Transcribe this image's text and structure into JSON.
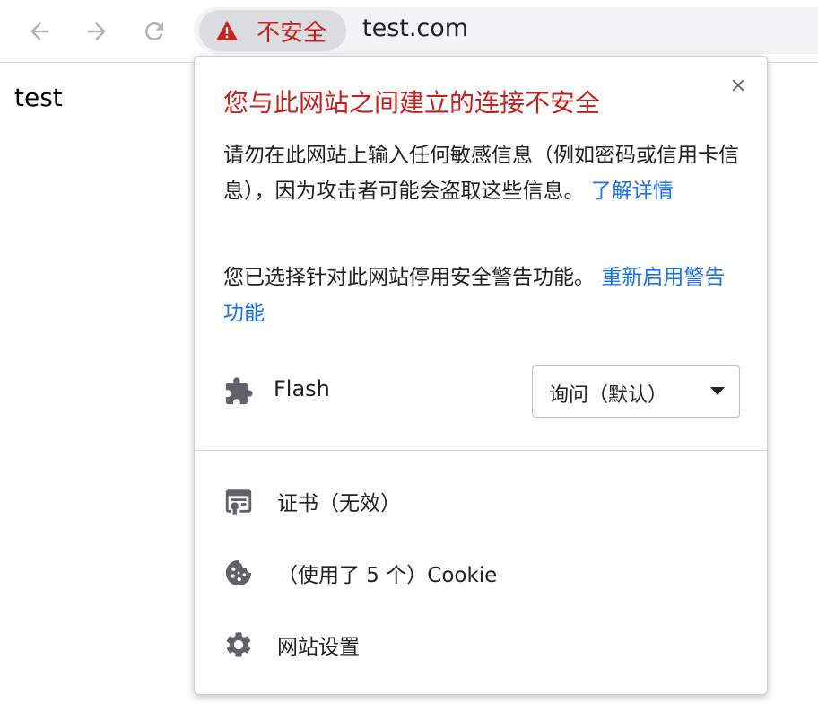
{
  "toolbar": {
    "security_chip_label": "不安全",
    "url": "test.com"
  },
  "page": {
    "body_text": "test"
  },
  "popup": {
    "title": "您与此网站之间建立的连接不安全",
    "para1_text": "请勿在此网站上输入任何敏感信息（例如密码或信用卡信息），因为攻击者可能会盗取这些信息。",
    "para1_link": "了解详情",
    "para2_text": "您已选择针对此网站停用安全警告功能。",
    "para2_link": "重新启用警告功能",
    "flash": {
      "label": "Flash",
      "selected_option": "询问（默认）"
    },
    "menu_items": [
      {
        "label": "证书（无效）",
        "icon": "certificate-icon"
      },
      {
        "label": "（使用了 5 个）Cookie",
        "icon": "cookie-icon"
      },
      {
        "label": "网站设置",
        "icon": "gear-icon"
      }
    ]
  },
  "colors": {
    "warning_red": "#c5221f",
    "link_blue": "#1a73e8",
    "icon_gray": "#5f6368",
    "nav_icon_gray": "#b0b3b7"
  },
  "icons": {
    "back": "back-arrow-icon",
    "forward": "forward-arrow-icon",
    "reload": "reload-icon",
    "warning": "warning-triangle-icon",
    "close": "close-icon",
    "flash": "puzzle-piece-icon",
    "dropdown": "chevron-down-icon"
  }
}
